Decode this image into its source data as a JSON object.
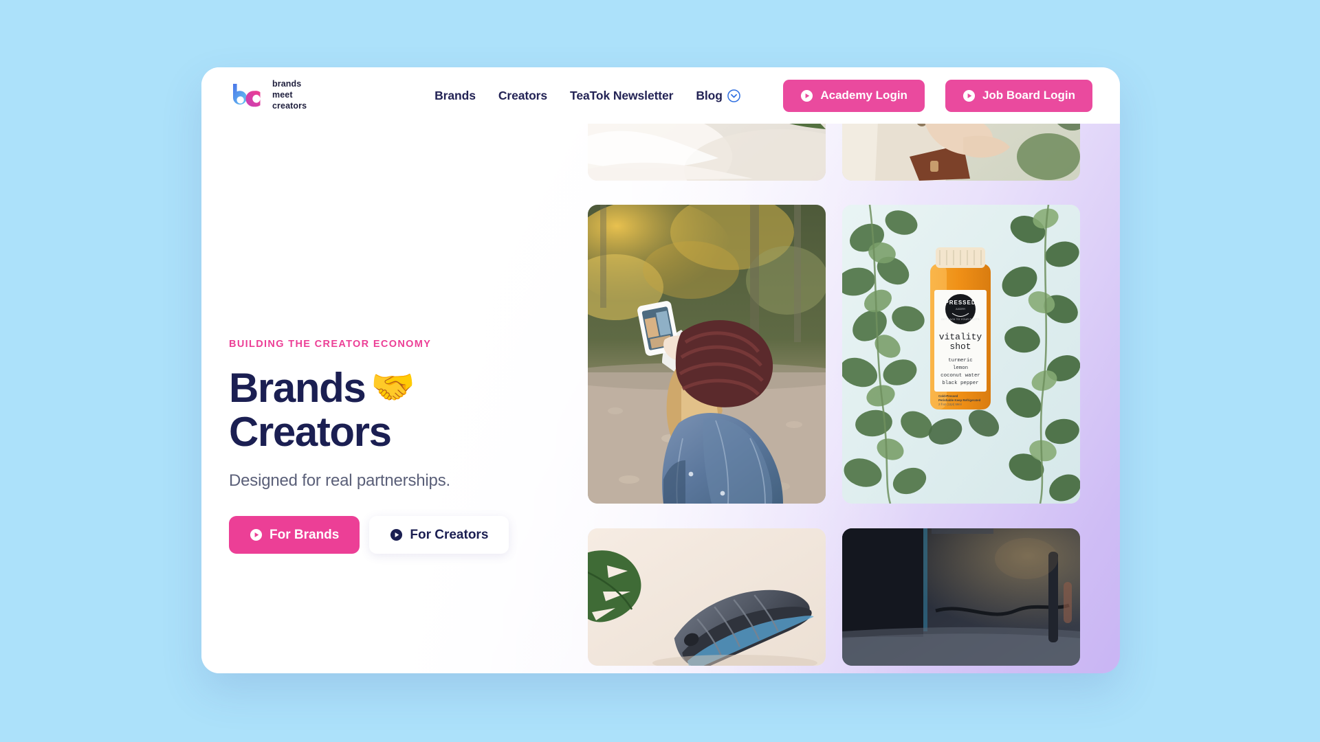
{
  "brand": {
    "logo_line1": "brands",
    "logo_line2": "meet",
    "logo_line3": "creators",
    "logo_letter_b": "b",
    "logo_letter_c": "c"
  },
  "colors": {
    "page_background": "#ace1fa",
    "accent_pink": "#ec3f96",
    "button_pink": "#ea4a9e",
    "navy": "#1b1f52",
    "card_gradient_end": "#c9b5f4"
  },
  "nav": {
    "items": [
      {
        "label": "Brands"
      },
      {
        "label": "Creators"
      },
      {
        "label": "TeaTok Newsletter"
      },
      {
        "label": "Blog",
        "has_dropdown": true
      }
    ]
  },
  "header_actions": {
    "academy_login": "Academy Login",
    "job_board_login": "Job Board Login"
  },
  "hero": {
    "eyebrow": "BUILDING THE CREATOR ECONOMY",
    "headline_line1": "Brands",
    "headline_emoji": "🤝",
    "headline_line2": "Creators",
    "subhead": "Designed for real partnerships.",
    "cta_primary": "For Brands",
    "cta_secondary": "For Creators"
  },
  "gallery": {
    "tiles": [
      {
        "id": "tile-a",
        "alt": "Orange skincare serum bottles on white fabric with green leaves"
      },
      {
        "id": "tile-b",
        "alt": "Woman in white blouse holding a navy skincare gift box"
      },
      {
        "id": "tile-c",
        "alt": "Woman in burgundy knit beanie and denim jacket photographing autumn forest with phone"
      },
      {
        "id": "tile-d",
        "alt": "Pressed vitality shot orange bottle on eucalyptus leaves"
      },
      {
        "id": "tile-e",
        "alt": "Grey sneaker on cream background beside a monstera leaf"
      },
      {
        "id": "tile-f",
        "alt": "Dark desk workspace scene"
      }
    ],
    "product_label": {
      "brand": "PRESSED",
      "tagline": "GET BACK TO YOUR ROOTS",
      "name_line1": "vitality",
      "name_line2": "shot",
      "ingredients": [
        "turmeric",
        "lemon",
        "coconut water",
        "black pepper"
      ],
      "footnote_line1": "Cold-Pressed",
      "footnote_line2": "Perishable Keep Refrigerated",
      "footnote_line3": "2 fl oz (12pt) 59ml"
    }
  },
  "icons": {
    "play_circle": "play-circle-icon",
    "chevron_down_circle": "chevron-down-circle-icon"
  }
}
